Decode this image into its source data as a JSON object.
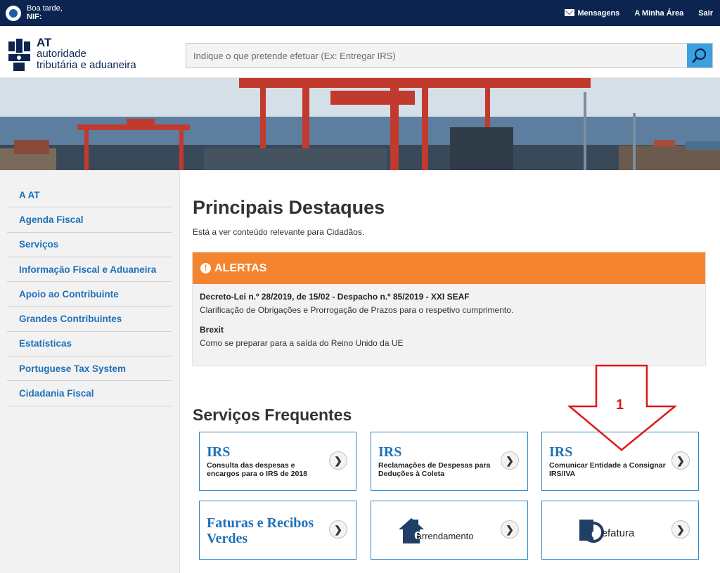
{
  "topbar": {
    "greeting": "Boa tarde,",
    "nif_label": "NIF:",
    "messages": "Mensagens",
    "my_area": "A Minha Área",
    "logout": "Sair"
  },
  "logo": {
    "line1": "AT",
    "line2": "autoridade",
    "line3": "tributária e aduaneira"
  },
  "search": {
    "placeholder": "Indique o que pretende efetuar (Ex: Entregar IRS)"
  },
  "sidebar": {
    "items": [
      {
        "label": "A AT"
      },
      {
        "label": "Agenda Fiscal"
      },
      {
        "label": "Serviços"
      },
      {
        "label": "Informação Fiscal e Aduaneira"
      },
      {
        "label": "Apoio ao Contribuinte"
      },
      {
        "label": "Grandes Contribuintes"
      },
      {
        "label": "Estatísticas"
      },
      {
        "label": "Portuguese Tax System"
      },
      {
        "label": "Cidadania Fiscal"
      }
    ]
  },
  "main": {
    "title": "Principais Destaques",
    "subtitle": "Está a ver conteúdo relevante para Cidadãos.",
    "alerts": {
      "header": "ALERTAS",
      "items": [
        {
          "title": "Decreto-Lei n.º 28/2019, de 15/02 - Despacho n.º 85/2019 - XXI SEAF",
          "desc": "Clarificação de Obrigações e Prorrogação de Prazos para o respetivo cumprimento."
        },
        {
          "title": "Brexit",
          "desc": "Como se preparar para a saída do Reino Unido da UE"
        }
      ]
    },
    "services_title": "Serviços Frequentes",
    "cards": [
      {
        "heading": "IRS",
        "desc": "Consulta das despesas e encargos para o IRS de 2018"
      },
      {
        "heading": "IRS",
        "desc": "Reclamações de Despesas para Deduções à Coleta"
      },
      {
        "heading": "IRS",
        "desc": "Comunicar Entidade a Consignar IRS/IVA"
      },
      {
        "heading": "Faturas e Recibos Verdes"
      },
      {
        "brand_prefix": "e",
        "brand": "arrendamento"
      },
      {
        "brand_prefix": "e",
        "brand": "efatura"
      }
    ]
  },
  "annotation": {
    "number": "1",
    "color": "#e0161b"
  },
  "colors": {
    "topbar": "#0b2550",
    "link": "#1f71b8",
    "alert": "#f5842e",
    "search_button": "#3aa0e0"
  }
}
